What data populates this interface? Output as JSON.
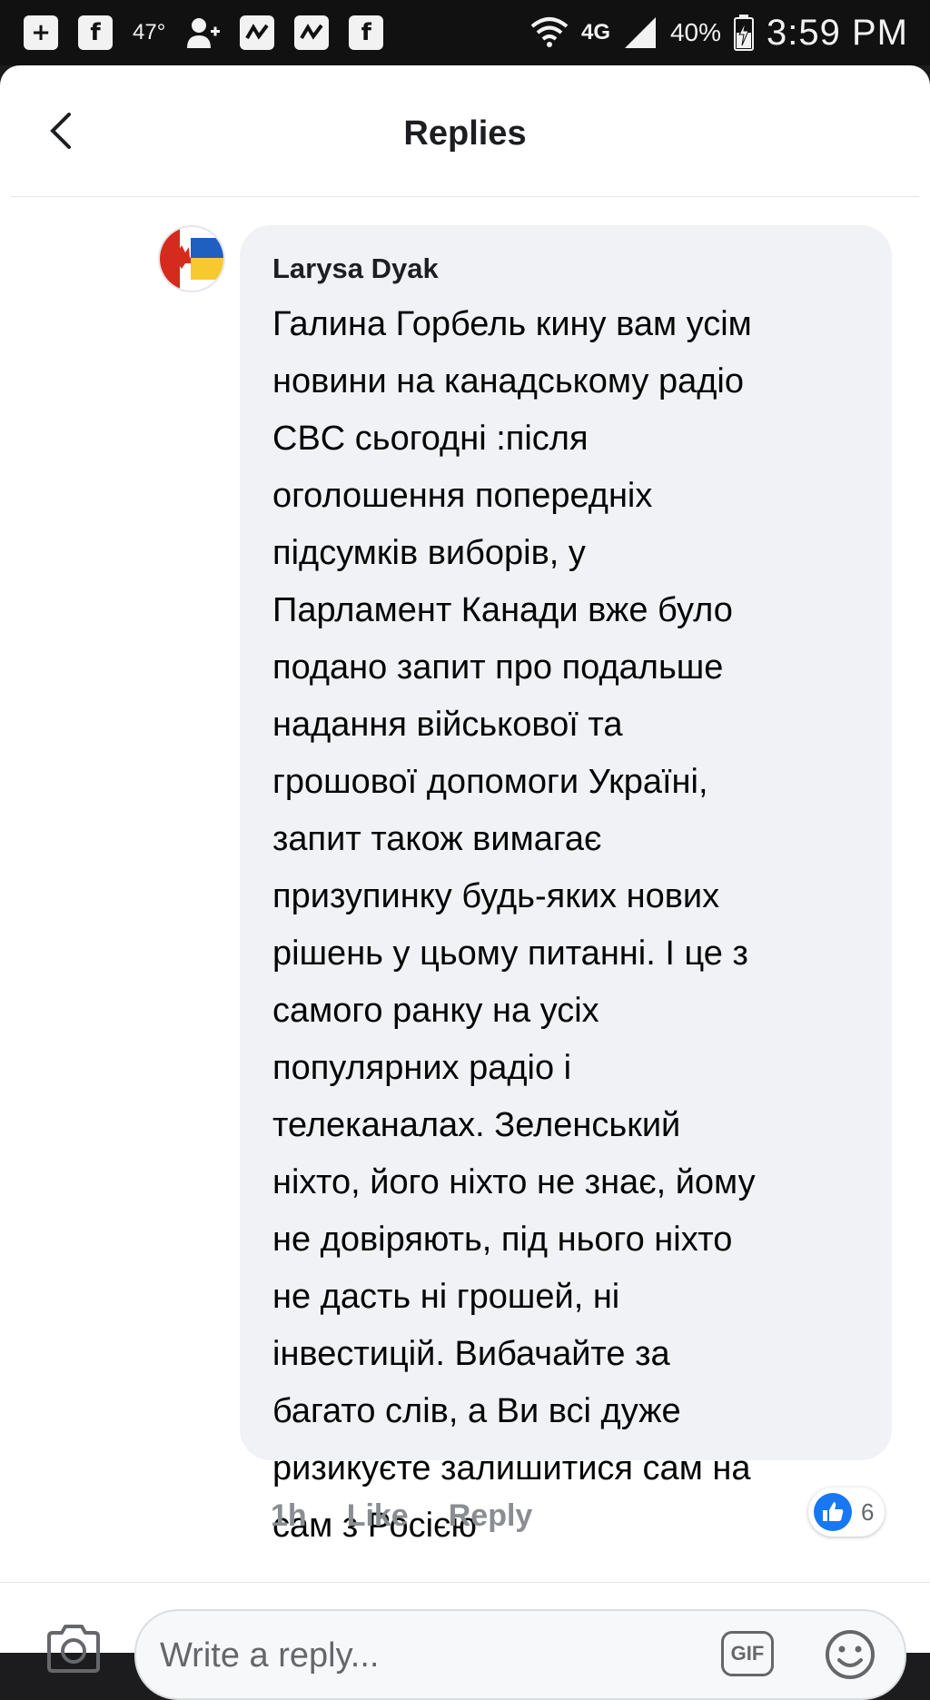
{
  "status_bar": {
    "temperature": "47°",
    "network": "4G",
    "battery": "40%",
    "time": "3:59 PM",
    "icons": [
      "plus-box-icon",
      "facebook-icon",
      "person-add-icon",
      "activity-icon",
      "activity-icon",
      "facebook-icon",
      "wifi-icon",
      "signal-icon",
      "battery-charging-icon"
    ]
  },
  "header": {
    "title": "Replies",
    "back_icon": "chevron-left-icon"
  },
  "comment": {
    "author": "Larysa Dyak",
    "avatar_icon": "flag-avatar-icon",
    "text_lines": [
      "Галина Горбель кину вам усім",
      "новини на канадському радіо",
      "CBC сьогодні :після",
      "оголошення попередніх",
      "підсумків виборів, у",
      "Парламент Канади вже було",
      "подано запит про подальше",
      "надання військової та",
      "грошової допомоги Україні,",
      "запит також вимагає",
      "призупинку будь-яких нових",
      "рішень у цьому питанні. І це з",
      "самого ранку на усіх",
      "популярних радіо і",
      "телеканалах. Зеленський",
      "ніхто, його ніхто не знає, йому",
      "не довіряють, під нього ніхто",
      "не дасть ні грошей, ні",
      "інвестицій. Вибачайте за",
      "багато слів, а Ви всі дуже",
      "ризикуєте залишитися сам на",
      "сам з Росією"
    ],
    "time": "1h",
    "like_label": "Like",
    "reply_label": "Reply",
    "reaction_count": "6",
    "reaction_icon": "like-thumb-icon"
  },
  "composer": {
    "placeholder": "Write a reply...",
    "camera_icon": "camera-icon",
    "gif_label": "GIF",
    "emoji_icon": "smiley-icon"
  },
  "colors": {
    "accent": "#1877f2",
    "bubble": "#f0f2f5",
    "muted_text": "#8a8d91"
  }
}
